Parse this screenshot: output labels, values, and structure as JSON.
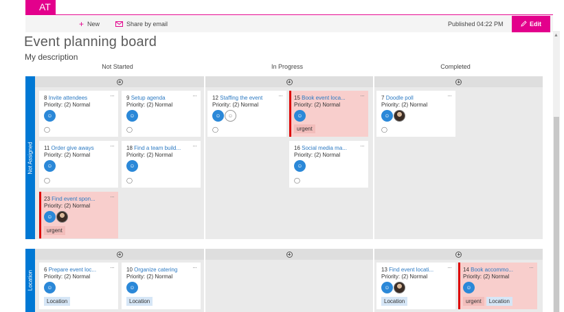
{
  "header": {
    "site_initials": "AT",
    "new_label": "New",
    "share_label": "Share by email",
    "published": "Published 04:22 PM",
    "edit_label": "Edit"
  },
  "page": {
    "title": "Event planning board",
    "description": "My description"
  },
  "columns": [
    "Not Started",
    "In Progress",
    "Completed"
  ],
  "lanes": [
    "Not Assigned",
    "Location"
  ],
  "cards": [
    {
      "id": "8",
      "title": "Invite attendees",
      "priority": "Priority: (2) Normal"
    },
    {
      "id": "9",
      "title": "Setup agenda",
      "priority": "Priority: (2) Normal"
    },
    {
      "id": "11",
      "title": "Order give aways",
      "priority": "Priority: (2) Normal"
    },
    {
      "id": "18",
      "title": "Find a team build...",
      "priority": "Priority: (2) Normal"
    },
    {
      "id": "23",
      "title": "Find event spon...",
      "priority": "Priority: (2) Normal",
      "tags": [
        "urgent"
      ]
    },
    {
      "id": "12",
      "title": "Staffing the event",
      "priority": "Priority: (2) Normal"
    },
    {
      "id": "15",
      "title": "Book event loca...",
      "priority": "Priority: (2) Normal",
      "tags": [
        "urgent"
      ]
    },
    {
      "id": "16",
      "title": "Social media ma...",
      "priority": "Priority: (2) Normal"
    },
    {
      "id": "7",
      "title": "Doodle poll",
      "priority": "Priority: (2) Normal"
    },
    {
      "id": "6",
      "title": "Prepare event loc...",
      "priority": "Priority: (2) Normal",
      "tags": [
        "Location"
      ]
    },
    {
      "id": "10",
      "title": "Organize catering",
      "priority": "Priority: (2) Normal",
      "tags": [
        "Location"
      ]
    },
    {
      "id": "13",
      "title": "Find event locati...",
      "priority": "Priority: (2) Normal",
      "tags": [
        "Location"
      ]
    },
    {
      "id": "14",
      "title": "Book accommo...",
      "priority": "Priority: (2) Normal",
      "tags": [
        "urgent",
        "Location"
      ]
    }
  ],
  "colors": {
    "accent": "#e3008c",
    "lane_tag": "#0078d4",
    "urgent_card": "#f8cecc",
    "urgent_bar": "#dd0000",
    "avatar": "#2b88d8"
  }
}
